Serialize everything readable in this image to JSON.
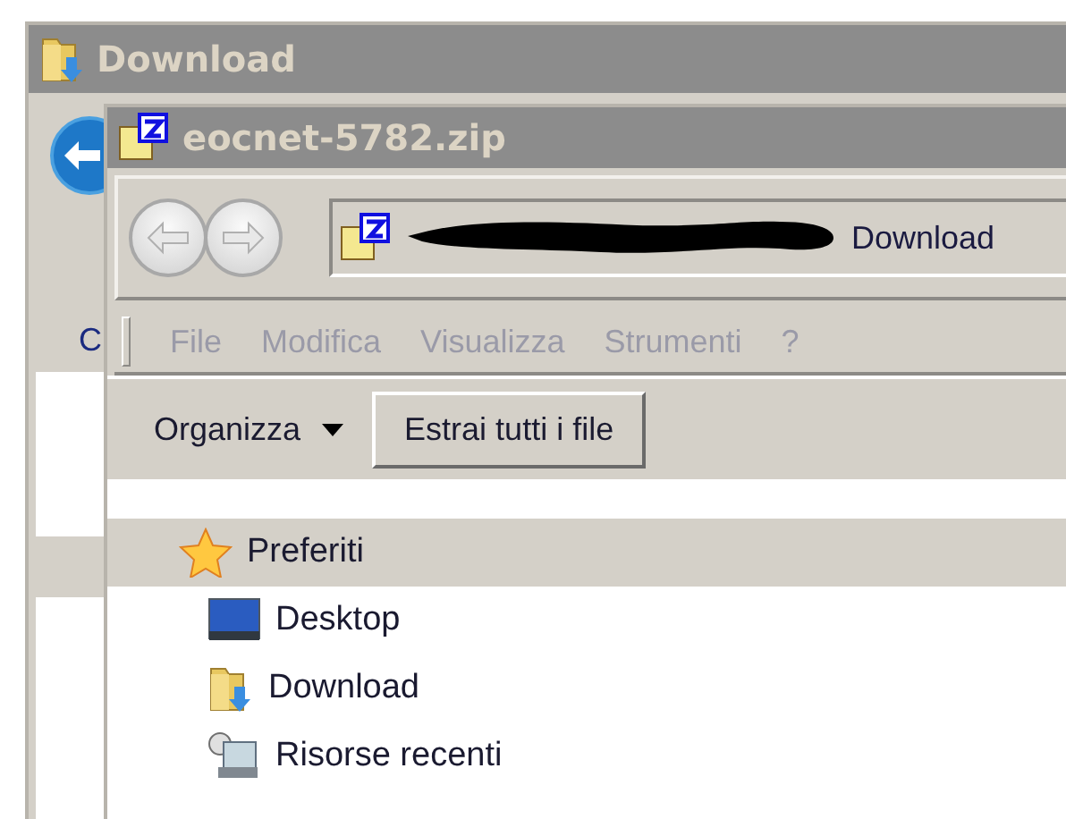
{
  "back_window": {
    "title": "Download",
    "menu_fragment": "C"
  },
  "front_window": {
    "title": "eocnet-5782.zip",
    "address": {
      "location": "Download"
    },
    "menu": [
      {
        "label": "File",
        "disabled": true
      },
      {
        "label": "Modifica",
        "disabled": true
      },
      {
        "label": "Visualizza",
        "disabled": true
      },
      {
        "label": "Strumenti",
        "disabled": true
      },
      {
        "label": "?",
        "disabled": true
      }
    ],
    "toolbar": [
      {
        "kind": "menu",
        "label": "Organizza"
      },
      {
        "kind": "button",
        "label": "Estrai tutti i file"
      }
    ],
    "navigation": [
      {
        "label": "Preferiti",
        "kind": "star",
        "selected": true,
        "children": [
          {
            "label": "Desktop",
            "kind": "desktop",
            "selected": false
          },
          {
            "label": "Download",
            "kind": "download",
            "selected": false
          },
          {
            "label": "Risorse recenti",
            "kind": "recent",
            "selected": false
          }
        ]
      }
    ]
  }
}
